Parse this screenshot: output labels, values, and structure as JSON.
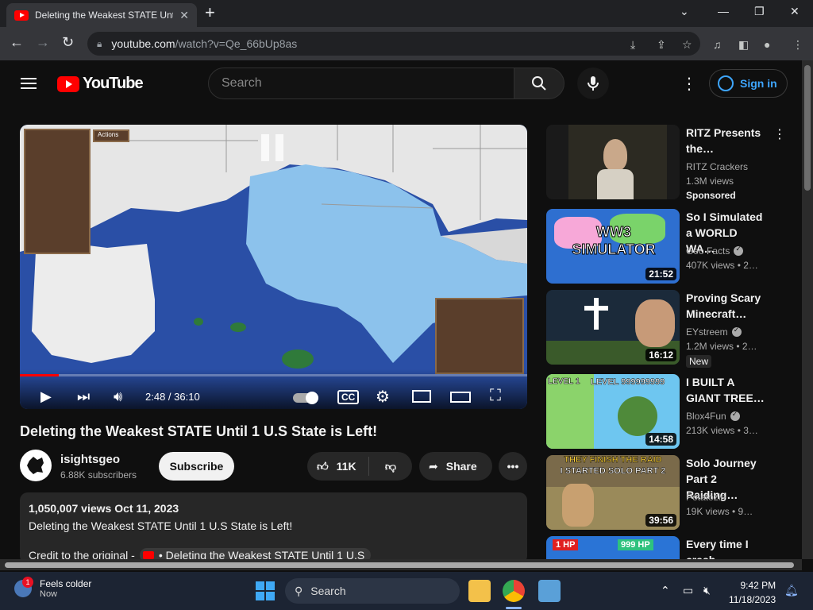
{
  "browser": {
    "tab_title": "Deleting the Weakest STATE Until 1 U.S State is Left!",
    "url_host": "youtube.com",
    "url_path": "/watch?v=Qe_66bUp8as"
  },
  "masthead": {
    "logo_text": "YouTube",
    "search_placeholder": "Search",
    "signin_label": "Sign in"
  },
  "player": {
    "time": "2:48 / 36:10",
    "progress_fraction": 0.077,
    "hud_label": "Actions"
  },
  "video": {
    "title": "Deleting the Weakest STATE Until 1 U.S State is Left!",
    "channel": "isightsgeo",
    "subscribers": "6.88K subscribers",
    "subscribe_label": "Subscribe",
    "likes": "11K",
    "share_label": "Share",
    "description_meta": "1,050,007 views  Oct 11, 2023",
    "description_line": "Deleting the Weakest STATE Until 1 U.S State is Left!",
    "credit_prefix": "Credit to the original -",
    "credit_chip": "• Deleting the Weakest STATE Until 1 U.S"
  },
  "recommendations": [
    {
      "title": "RITZ Presents the…",
      "channel": "RITZ Crackers",
      "views": "1.3M views",
      "badge": "Sponsored",
      "duration": "",
      "verified": false
    },
    {
      "title": "So I Simulated a WORLD WA…",
      "channel": "Geo Facts",
      "views": "407K views  •  2…",
      "badge": "",
      "duration": "21:52",
      "verified": true,
      "thumb_text": "WW3 SIMULATOR"
    },
    {
      "title": "Proving Scary Minecraft…",
      "channel": "EYstreem",
      "views": "1.2M views  •  2…",
      "badge": "New",
      "duration": "16:12",
      "verified": true
    },
    {
      "title": "I BUILT A GIANT TREE…",
      "channel": "Blox4Fun",
      "views": "213K views  •  3…",
      "badge": "",
      "duration": "14:58",
      "verified": true,
      "thumb_text": "LEVEL 1",
      "thumb_text2": "LEVEL 999999999"
    },
    {
      "title": "Solo Journey Part 2 Raiding…",
      "channel": "Potatozie",
      "views": "19K views  •  9…",
      "badge": "",
      "duration": "39:56",
      "verified": false,
      "thumb_text": "THEY FINISH THE RAID",
      "thumb_text2": "I STARTED SOLO PART 2"
    },
    {
      "title": "Every time I crash…",
      "channel": "",
      "views": "",
      "badge": "",
      "duration": "",
      "verified": false,
      "thumb_text": "1 HP",
      "thumb_text2": "999 HP"
    }
  ],
  "taskbar": {
    "weather_title": "Feels colder",
    "weather_sub": "Now",
    "weather_badge": "1",
    "search_label": "Search",
    "time": "9:42 PM",
    "date": "11/18/2023"
  },
  "colors": {
    "accent_red": "#ff0000",
    "link_blue": "#3ea6ff",
    "background": "#0f0f0f"
  }
}
